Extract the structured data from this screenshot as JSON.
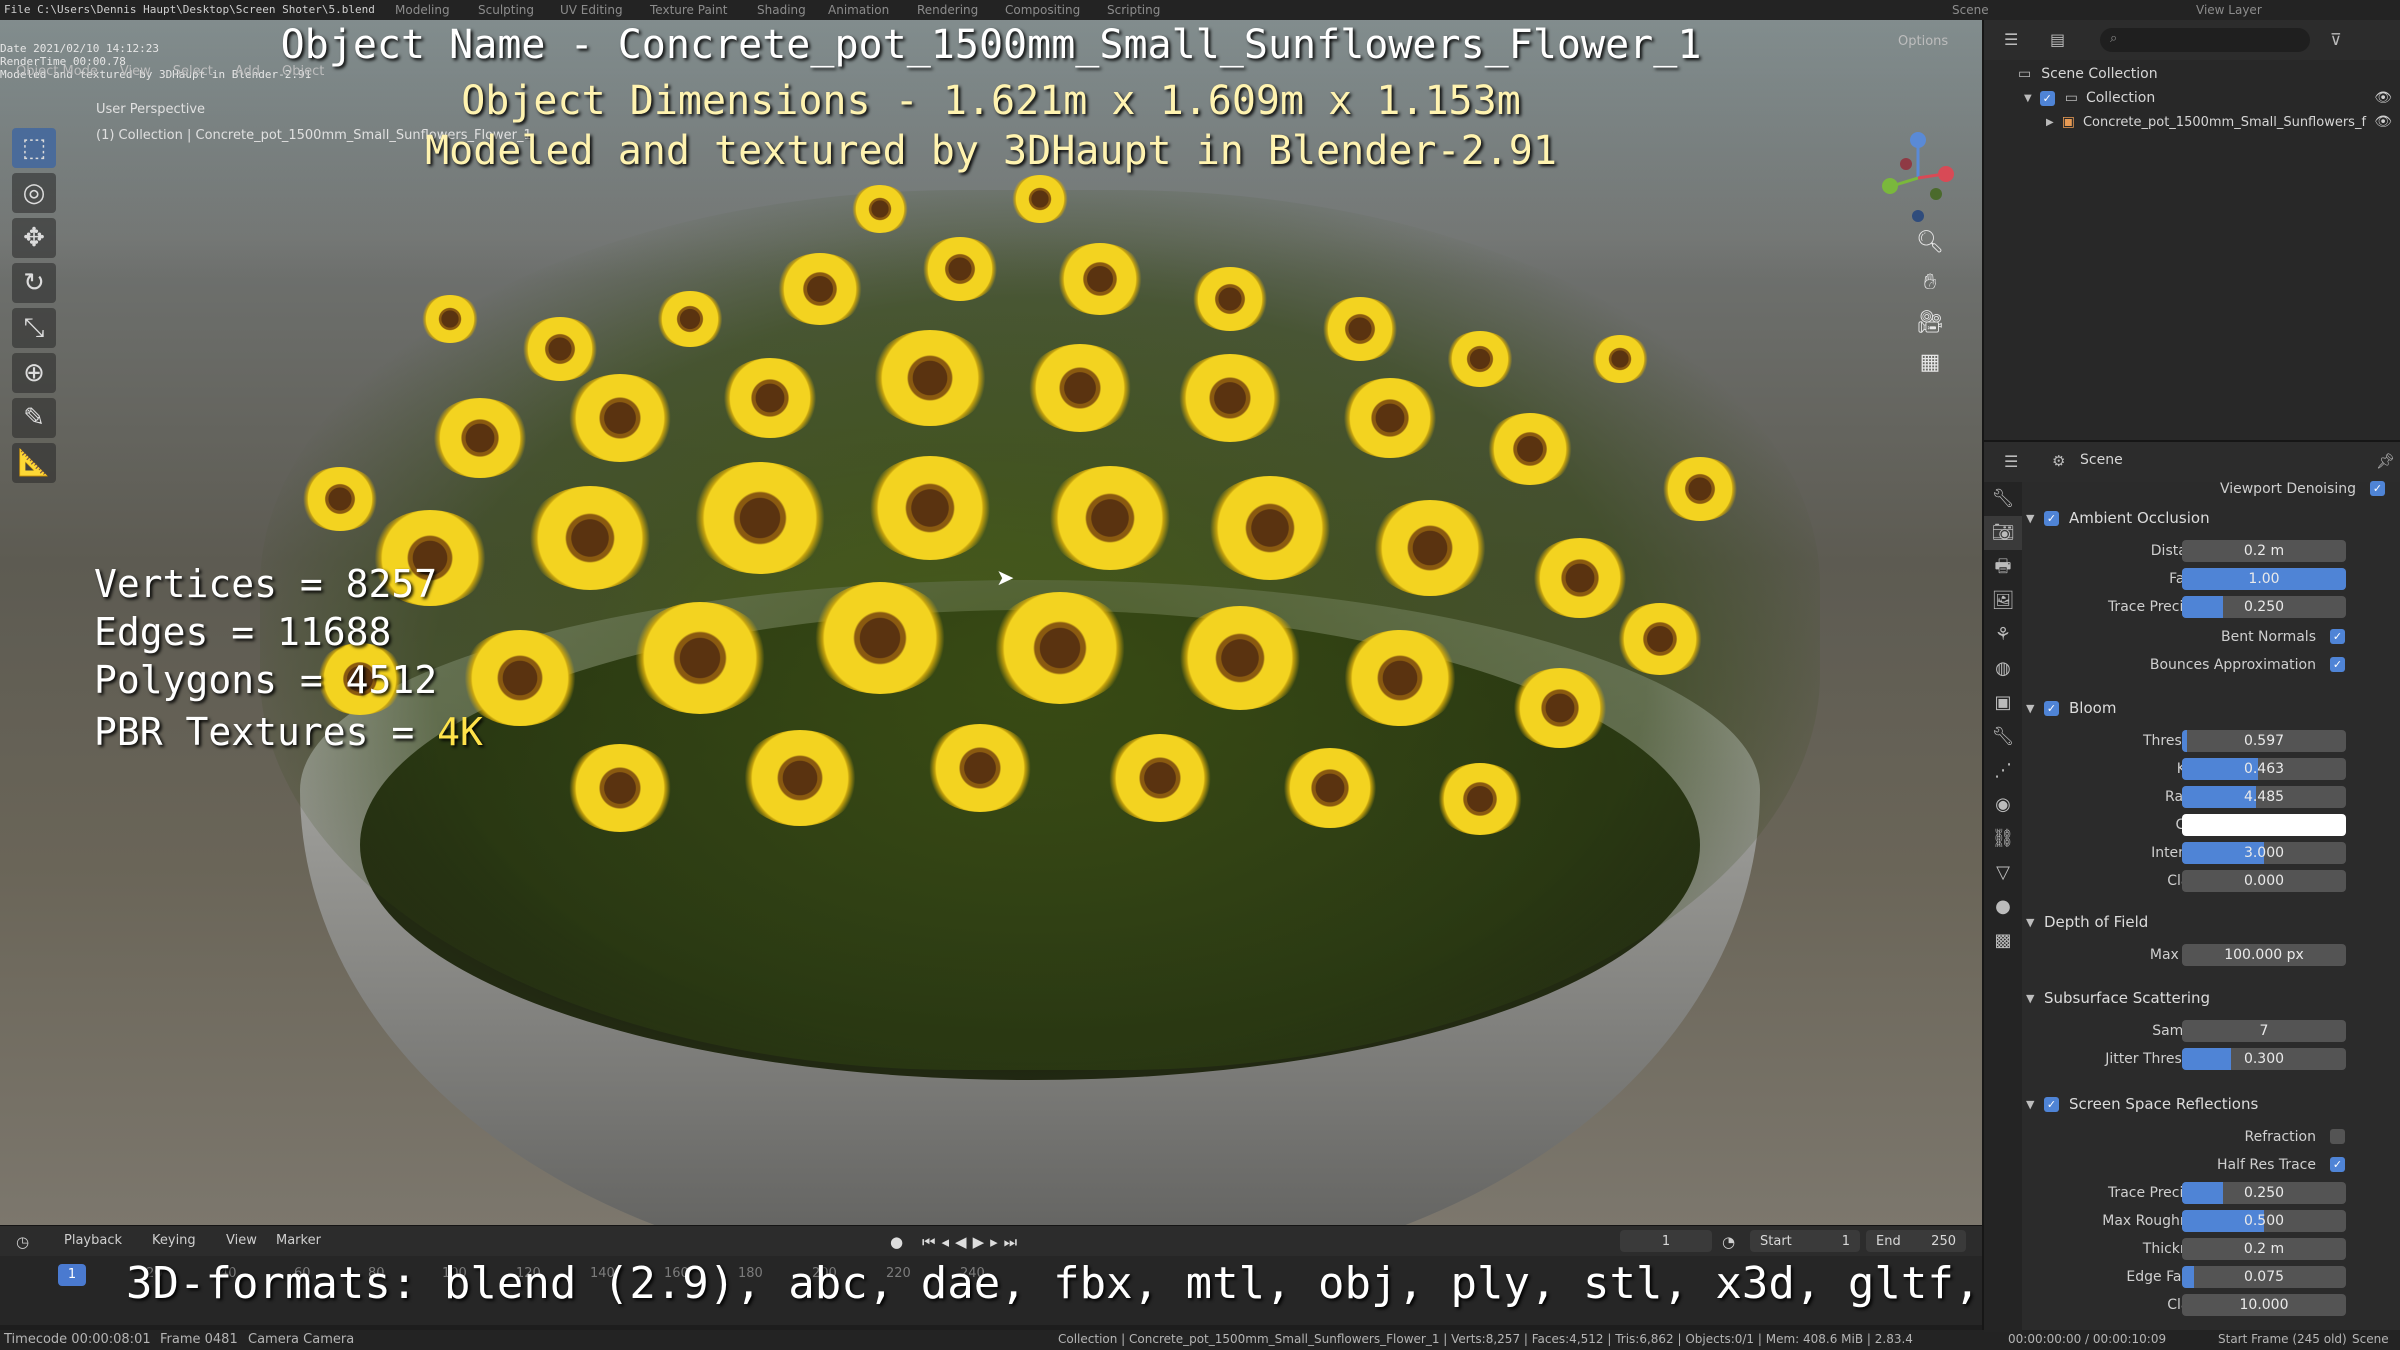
{
  "topbar": {
    "path": "File C:\\Users\\Dennis Haupt\\Desktop\\Screen Shoter\\5.blend",
    "workspaces": [
      "Modeling",
      "Sculpting",
      "UV Editing",
      "Texture Paint",
      "Shading",
      "Animation",
      "Rendering",
      "Compositing",
      "Scripting"
    ],
    "scene_label": "Scene",
    "view_layer_label": "View Layer"
  },
  "sysinfo": {
    "date": "Date 2021/02/10 14:12:23",
    "rendertime": "RenderTime 00:00.78",
    "modeled": "Modeled and textured by 3DHaupt in Blender-2.91"
  },
  "viewport": {
    "header_items": [
      "Object Mode",
      "View",
      "Select",
      "Add",
      "Object"
    ],
    "perspective": "User Perspective",
    "collection_info": "(1) Collection | Concrete_pot_1500mm_Small_Sunflowers_Flower_1",
    "options_label": "Options"
  },
  "overlay": {
    "title": "Object Name - Concrete_pot_1500mm_Small_Sunflowers_Flower_1",
    "dimensions": "Object Dimensions -  1.621m x 1.609m x 1.153m",
    "credit": "Modeled and textured by 3DHaupt in Blender-2.91",
    "vertices": "Vertices = 8257",
    "edges": "Edges = 11688",
    "polygons": "Polygons = 4512",
    "pbr_prefix": "PBR Textures = ",
    "pbr_value": "4K",
    "formats": "3D-formats: blend (2.9), abc, dae, fbx, mtl, obj, ply, stl, x3d, gltf, dxf"
  },
  "tools": [
    {
      "name": "select-box-tool",
      "icon": "⬚"
    },
    {
      "name": "cursor-tool",
      "icon": "◎"
    },
    {
      "name": "move-tool",
      "icon": "✥"
    },
    {
      "name": "rotate-tool",
      "icon": "↻"
    },
    {
      "name": "scale-tool",
      "icon": "⤡"
    },
    {
      "name": "transform-tool",
      "icon": "⊕"
    },
    {
      "name": "annotate-tool",
      "icon": "✎"
    },
    {
      "name": "measure-tool",
      "icon": "📐"
    }
  ],
  "timeline": {
    "menus": [
      "Playback",
      "Keying",
      "View",
      "Marker"
    ],
    "current_frame": "1",
    "start_label": "Start",
    "start_value": "1",
    "end_label": "End",
    "end_value": "250",
    "ruler": [
      "0",
      "20",
      "40",
      "60",
      "80",
      "100",
      "120",
      "140",
      "160",
      "180",
      "200",
      "220",
      "240"
    ],
    "playhead": "1"
  },
  "statusbar": {
    "timecode": "Timecode 00:00:08:01",
    "frame": "Frame 0481",
    "camera": "Camera Camera",
    "stats": "Collection | Concrete_pot_1500mm_Small_Sunflowers_Flower_1 | Verts:8,257 | Faces:4,512 | Tris:6,862 | Objects:0/1 | Mem: 408.6 MiB | 2.83.4",
    "right_time": "00:00:00:00 / 00:00:10:09",
    "right_frame": "Start Frame (245 old)",
    "right_scene": "Scene"
  },
  "outliner": {
    "rows": [
      {
        "label": "Scene Collection"
      },
      {
        "label": "Collection"
      },
      {
        "label": "Concrete_pot_1500mm_Small_Sunflowers_f"
      }
    ]
  },
  "properties": {
    "header": "Scene",
    "viewport_denoising": "Viewport Denoising",
    "sections": [
      {
        "label": "Ambient Occlusion",
        "checked": true
      },
      {
        "label": "Bloom",
        "checked": true
      },
      {
        "label": "Depth of Field",
        "checked": null
      },
      {
        "label": "Subsurface Scattering",
        "checked": null
      },
      {
        "label": "Screen Space Reflections",
        "checked": true
      }
    ],
    "ao": {
      "distance_label": "Distance",
      "distance": "0.2 m",
      "factor_label": "Factor",
      "factor": "1.00",
      "factor_fill": 1.0,
      "trace_label": "Trace Precision",
      "trace": "0.250",
      "trace_fill": 0.25,
      "bent_label": "Bent Normals",
      "bounces_label": "Bounces Approximation"
    },
    "bloom": {
      "threshold_label": "Threshold",
      "threshold": "0.597",
      "threshold_fill": 0.03,
      "knee_label": "Knee",
      "knee": "0.463",
      "knee_fill": 0.463,
      "radius_label": "Radius",
      "radius": "4.485",
      "radius_fill": 0.45,
      "color_label": "Color",
      "color": "#ffffff",
      "intensity_label": "Intensity",
      "intensity": "3.000",
      "intensity_fill": 0.5,
      "clamp_label": "Clamp",
      "clamp": "0.000"
    },
    "dof": {
      "maxsize_label": "Max Size",
      "maxsize": "100.000 px"
    },
    "sss": {
      "samples_label": "Samples",
      "samples": "7",
      "jitter_label": "Jitter Threshold",
      "jitter": "0.300",
      "jitter_fill": 0.3
    },
    "ssr": {
      "refraction_label": "Refraction",
      "halfres_label": "Half Res Trace",
      "trace_label": "Trace Precision",
      "trace": "0.250",
      "trace_fill": 0.25,
      "rough_label": "Max Roughness",
      "rough": "0.500",
      "rough_fill": 0.5,
      "thick_label": "Thickness",
      "thick": "0.2 m",
      "edge_label": "Edge Fading",
      "edge": "0.075",
      "edge_fill": 0.075,
      "clamp_label": "Clamp",
      "clamp": "10.000"
    }
  },
  "colors": {
    "accent": "#4f84d6",
    "flower": "#f3d320",
    "highlight_text": "#ffe34a"
  }
}
